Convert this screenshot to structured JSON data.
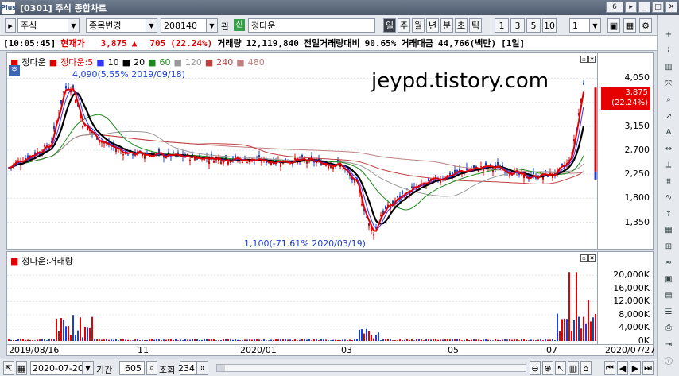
{
  "window": {
    "title": "[0301] 주식 종합차트",
    "logo": "Plus",
    "page_counter": "6",
    "win_icons": [
      "arrow-icon",
      "minimize-icon",
      "restore-icon",
      "close-icon"
    ]
  },
  "toolbar": {
    "market": "주식",
    "change_label": "종목변경",
    "code": "208140",
    "paper_label": "관",
    "credit_badge": "신",
    "stock_name": "정다운",
    "periods": [
      "일",
      "주",
      "월",
      "년",
      "분",
      "초",
      "틱"
    ],
    "active_period": "일",
    "nums": [
      "1",
      "3",
      "5",
      "10"
    ],
    "qty": "1"
  },
  "info": {
    "time": "[10:05:45]",
    "price_label": "현재가",
    "price": "3,875",
    "change": "705",
    "pct": "(22.24%)",
    "vol_label": "거래량",
    "volume": "12,119,840",
    "prev_label": "전일거래량대비",
    "prev_ratio": "90.65%",
    "amt_label": "거래대금",
    "amount": "44,766(백만)",
    "term": "[1일]"
  },
  "price_panel": {
    "legend": {
      "name": "정다운",
      "ma_name": "정다운:5",
      "ma": [
        "10",
        "20",
        "60",
        "120",
        "240",
        "480"
      ]
    },
    "badge": "호",
    "watermark": "jeypd.tistory.com",
    "high_note": "4,090(5.55% 2019/09/18)",
    "low_note": "1,100(-71.61% 2020/03/19)",
    "yticks": [
      "4,050",
      "3,600",
      "3,150",
      "2,700",
      "2,250",
      "1,800",
      "1,350"
    ],
    "last_price": "3,875",
    "last_pct": "(22.24%)"
  },
  "volume_panel": {
    "legend": "정다운:거래량",
    "yticks": [
      "20,000K",
      "16,000K",
      "12,000K",
      "8,000K",
      "4,000K",
      "0K"
    ]
  },
  "xaxis": {
    "labels": [
      "2019/08/16",
      "11",
      "2020/01",
      "03",
      "05",
      "07",
      "2020/07/27"
    ]
  },
  "status": {
    "date": "2020-07-20",
    "period_label": "기간",
    "period": "605",
    "view_label": "조회",
    "view": "234"
  },
  "sidebar": {
    "items": [
      "tool",
      "chart-line",
      "chart-candle",
      "cross",
      "magnify",
      "trend",
      "auto",
      "measure",
      "ruler",
      "fib",
      "wave",
      "arrow-up",
      "pattern",
      "grid",
      "wave2",
      "save",
      "doc",
      "list",
      "print",
      "export",
      "info"
    ]
  },
  "colors": {
    "up": "#e60000",
    "down": "#1a3fd6",
    "ma5": "#e00000",
    "ma10": "#3333ff",
    "ma20": "#000000",
    "ma60": "#1a8a1a",
    "ma120": "#999999",
    "ma240": "#c04040",
    "ma480": "#c08080"
  }
}
